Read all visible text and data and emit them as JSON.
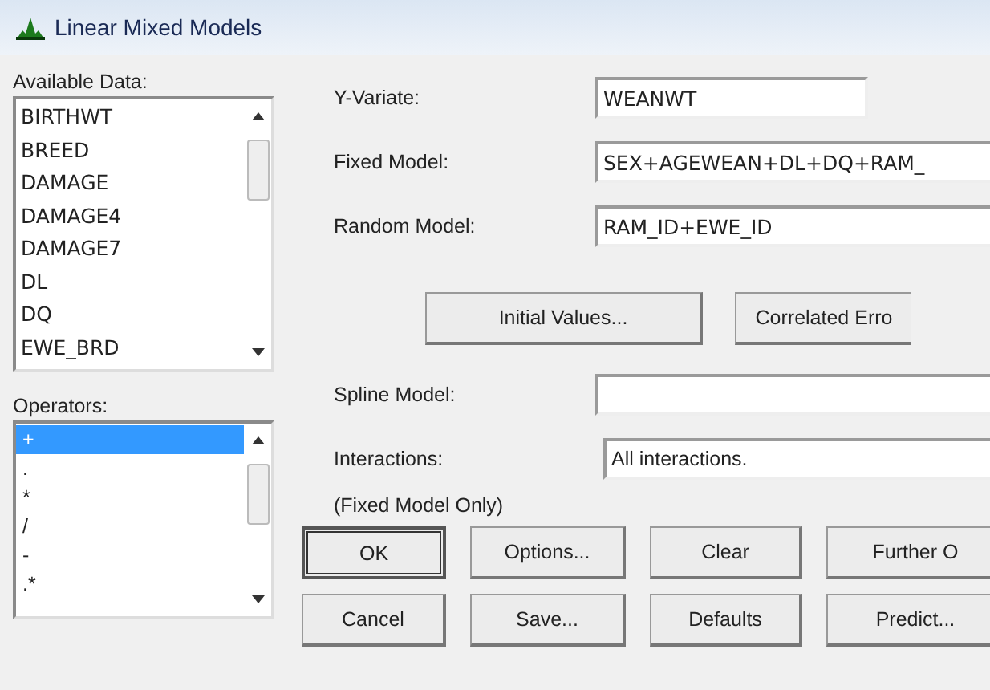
{
  "window": {
    "title": "Linear Mixed Models"
  },
  "available_data": {
    "label": "Available Data:",
    "items": [
      "BIRTHWT",
      "BREED",
      "DAMAGE",
      "DAMAGE4",
      "DAMAGE7",
      "DL",
      "DQ",
      "EWE_BRD"
    ]
  },
  "operators": {
    "label": "Operators:",
    "items": [
      {
        "text": "+",
        "selected": true
      },
      {
        "text": ".",
        "selected": false
      },
      {
        "text": "*",
        "selected": false
      },
      {
        "text": "/",
        "selected": false
      },
      {
        "text": "-",
        "selected": false
      },
      {
        "text": ".*",
        "selected": false
      }
    ]
  },
  "fields": [
    {
      "label": "Y-Variate:",
      "value": "WEANWT",
      "kind": "short"
    },
    {
      "label": "Fixed Model:",
      "value": "SEX+AGEWEAN+DL+DQ+RAM_",
      "kind": "long"
    },
    {
      "label": "Random Model:",
      "value": "RAM_ID+EWE_ID",
      "kind": "long"
    }
  ],
  "middle_buttons": [
    "Initial Values...",
    "Correlated Erro"
  ],
  "spline": {
    "label": "Spline Model:"
  },
  "interactions": {
    "label": "Interactions:",
    "value": "All interactions.",
    "note": "(Fixed Model Only)"
  },
  "buttons": [
    {
      "label": "OK",
      "default": true
    },
    {
      "label": "Options...",
      "default": false
    },
    {
      "label": "Clear",
      "default": false
    },
    {
      "label": "Further O",
      "default": false
    },
    {
      "label": "Cancel",
      "default": false
    },
    {
      "label": "Save...",
      "default": false
    },
    {
      "label": "Defaults",
      "default": false
    },
    {
      "label": "Predict...",
      "default": false
    }
  ]
}
